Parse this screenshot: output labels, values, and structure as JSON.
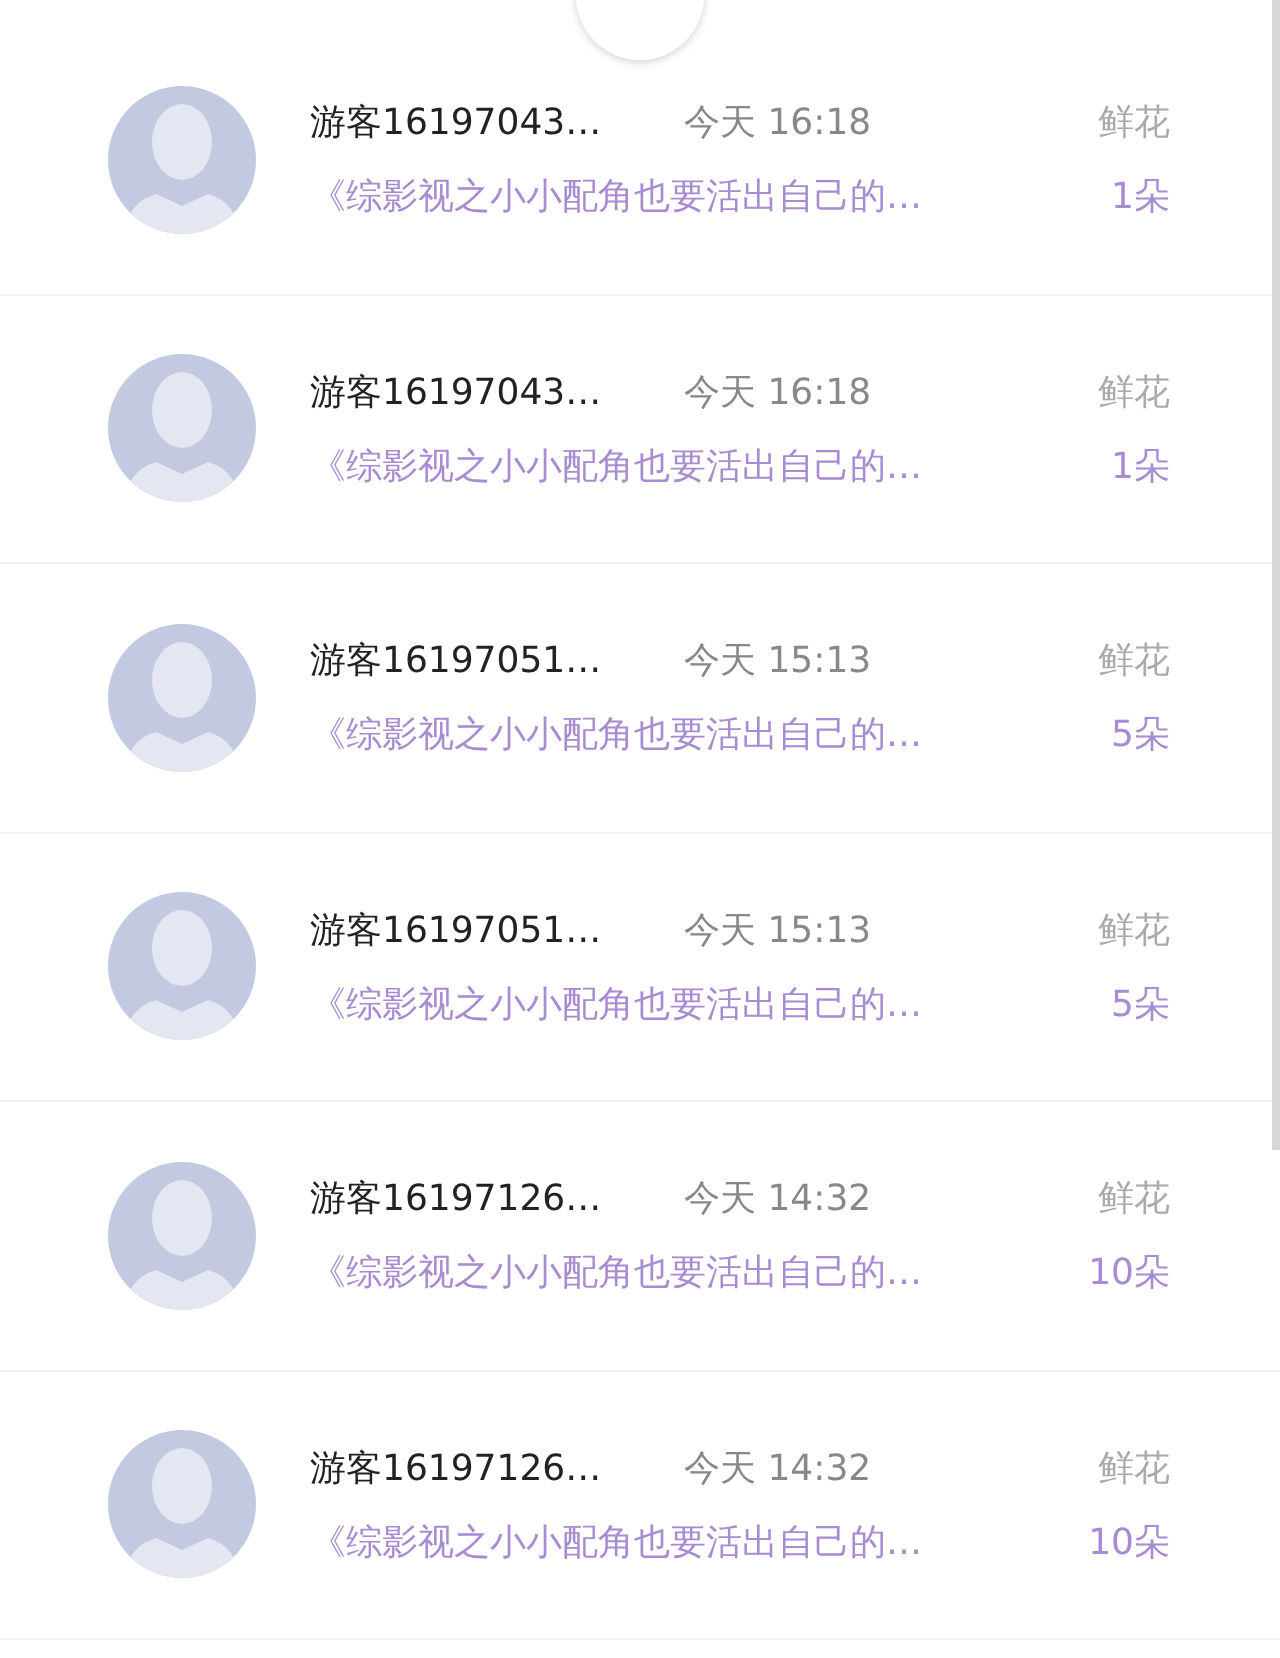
{
  "gifts": [
    {
      "user": "游客16197043…",
      "time": "今天 16:18",
      "gift": "鲜花",
      "book": "《综影视之小小配角也要活出自己的…",
      "count": "1朵"
    },
    {
      "user": "游客16197043…",
      "time": "今天 16:18",
      "gift": "鲜花",
      "book": "《综影视之小小配角也要活出自己的…",
      "count": "1朵"
    },
    {
      "user": "游客16197051…",
      "time": "今天 15:13",
      "gift": "鲜花",
      "book": "《综影视之小小配角也要活出自己的…",
      "count": "5朵"
    },
    {
      "user": "游客16197051…",
      "time": "今天 15:13",
      "gift": "鲜花",
      "book": "《综影视之小小配角也要活出自己的…",
      "count": "5朵"
    },
    {
      "user": "游客16197126…",
      "time": "今天 14:32",
      "gift": "鲜花",
      "book": "《综影视之小小配角也要活出自己的…",
      "count": "10朵"
    },
    {
      "user": "游客16197126…",
      "time": "今天 14:32",
      "gift": "鲜花",
      "book": "《综影视之小小配角也要活出自己的…",
      "count": "10朵"
    }
  ]
}
